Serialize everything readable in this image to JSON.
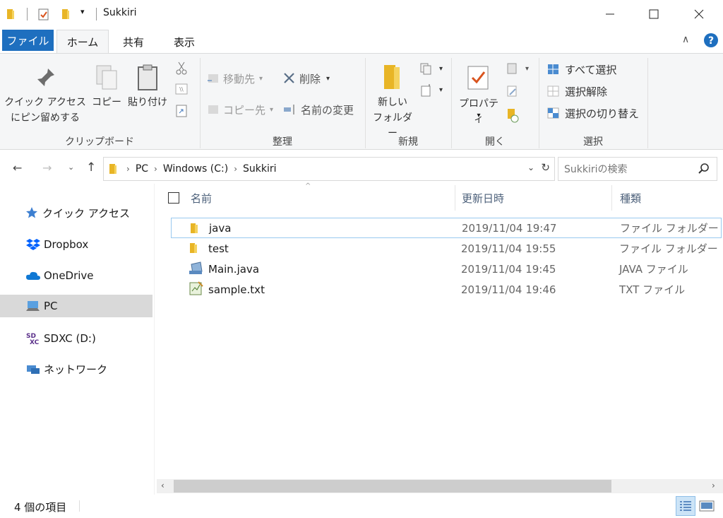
{
  "window": {
    "title": "Sukkiri"
  },
  "tabs": {
    "file": "ファイル",
    "home": "ホーム",
    "share": "共有",
    "view": "表示"
  },
  "ribbon": {
    "pin_line1": "クイック アクセス",
    "pin_line2": "にピン留めする",
    "copy": "コピー",
    "paste": "貼り付け",
    "move_to": "移動先",
    "copy_to": "コピー先",
    "delete": "削除",
    "rename": "名前の変更",
    "new_folder_line1": "新しい",
    "new_folder_line2": "フォルダー",
    "properties": "プロパティ",
    "select_all": "すべて選択",
    "select_none": "選択解除",
    "invert_selection": "選択の切り替え",
    "groups": {
      "clipboard": "クリップボード",
      "organize": "整理",
      "new": "新規",
      "open": "開く",
      "select": "選択"
    }
  },
  "address": {
    "crumbs": [
      "PC",
      "Windows (C:)",
      "Sukkiri"
    ],
    "search_placeholder": "Sukkiriの検索"
  },
  "nav": [
    {
      "label": "クイック アクセス",
      "icon": "star-icon"
    },
    {
      "label": "Dropbox",
      "icon": "dropbox-icon"
    },
    {
      "label": "OneDrive",
      "icon": "cloud-icon"
    },
    {
      "label": "PC",
      "icon": "pc-icon",
      "selected": true
    },
    {
      "label": "SDXC (D:)",
      "icon": "sd-card-icon"
    },
    {
      "label": "ネットワーク",
      "icon": "network-icon"
    }
  ],
  "columns": {
    "name": "名前",
    "date": "更新日時",
    "type": "種類"
  },
  "files": [
    {
      "name": "java",
      "date": "2019/11/04 19:47",
      "type": "ファイル フォルダー",
      "icon": "folder-icon"
    },
    {
      "name": "test",
      "date": "2019/11/04 19:55",
      "type": "ファイル フォルダー",
      "icon": "folder-icon"
    },
    {
      "name": "Main.java",
      "date": "2019/11/04 19:45",
      "type": "JAVA ファイル",
      "icon": "java-file-icon"
    },
    {
      "name": "sample.txt",
      "date": "2019/11/04 19:46",
      "type": "TXT ファイル",
      "icon": "text-file-icon"
    }
  ],
  "status": {
    "count": "4 個の項目"
  },
  "colors": {
    "accent": "#1e6fbf",
    "folder": "#f0c040",
    "selected_nav": "#d9d9d9"
  }
}
